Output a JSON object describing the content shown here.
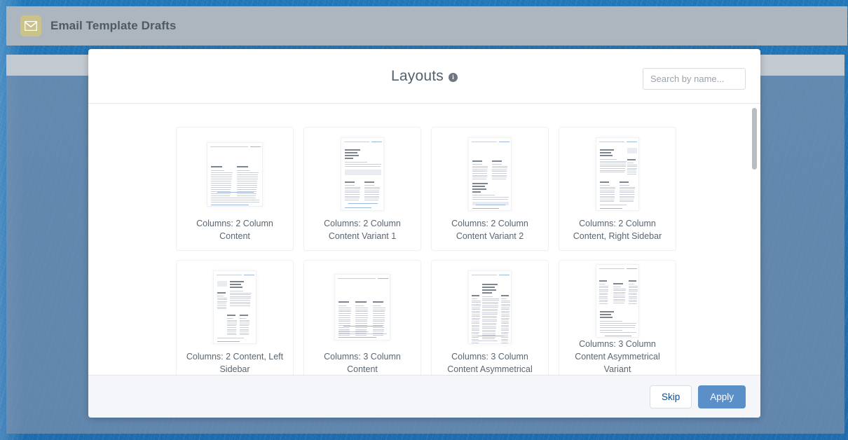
{
  "app": {
    "title": "Email Template Drafts",
    "icon": "envelope-icon",
    "icon_color": "#cbc28a",
    "header_color": "#adb6bf",
    "background_color": "#1f70b2"
  },
  "modal": {
    "title": "Layouts",
    "info_icon_glyph": "i",
    "search": {
      "placeholder": "Search by name...",
      "value": ""
    },
    "footer": {
      "skip_label": "Skip",
      "apply_label": "Apply",
      "apply_color": "#5b8fc7"
    },
    "layouts": [
      {
        "label": "Columns: 2 Column Content",
        "thumb": "two-col-wide"
      },
      {
        "label": "Columns: 2 Column Content Variant 1",
        "thumb": "two-col-variant-1"
      },
      {
        "label": "Columns: 2 Column Content Variant 2",
        "thumb": "two-col-variant-2"
      },
      {
        "label": "Columns: 2 Column Content, Right Sidebar",
        "thumb": "two-col-right-sidebar"
      },
      {
        "label": "Columns: 2 Content, Left Sidebar",
        "thumb": "two-content-left-sidebar"
      },
      {
        "label": "Columns: 3 Column Content",
        "thumb": "three-col"
      },
      {
        "label": "Columns: 3 Column Content Asymmetrical",
        "thumb": "three-col-asym"
      },
      {
        "label": "Columns: 3 Column Content Asymmetrical Variant",
        "thumb": "three-col-asym-variant"
      }
    ]
  }
}
